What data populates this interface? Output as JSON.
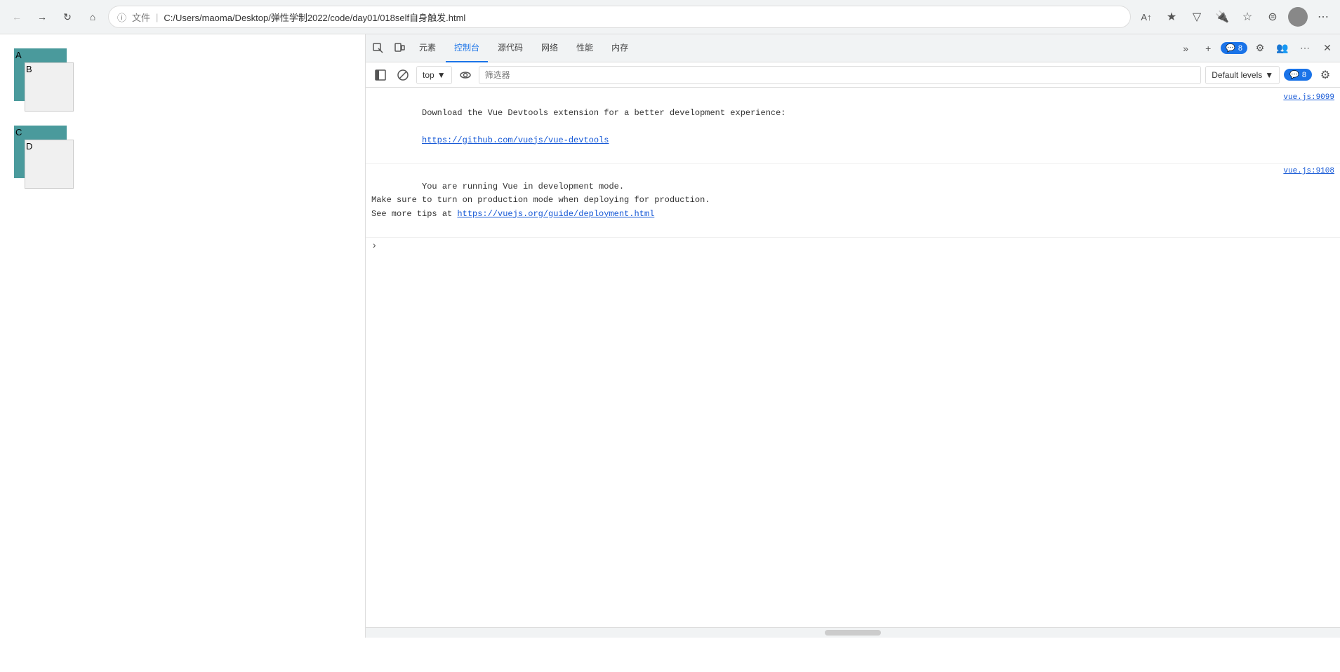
{
  "browser": {
    "back_label": "←",
    "forward_label": "→",
    "reload_label": "↻",
    "home_label": "⌂",
    "address_icon": "ℹ",
    "file_label": "文件",
    "address_text": "C:/Users/maoma/Desktop/弹性学制2022/code/day01/018self自身触发.html",
    "toolbar_icons": [
      "A↑",
      "☆",
      "▽",
      "🔔",
      "☆",
      "⊡",
      "👤",
      "···"
    ]
  },
  "devtools": {
    "tabs": [
      {
        "label": "元素",
        "active": false
      },
      {
        "label": "控制台",
        "active": true
      },
      {
        "label": "源代码",
        "active": false
      },
      {
        "label": "网络",
        "active": false
      },
      {
        "label": "性能",
        "active": false
      },
      {
        "label": "内存",
        "active": false
      }
    ],
    "more_tabs_label": "»",
    "add_tab_label": "+",
    "msg_count": "8",
    "settings_label": "⚙",
    "customize_label": "👥",
    "more_options_label": "···",
    "close_label": "✕",
    "console": {
      "clear_label": "🚫",
      "block_label": "⊘",
      "top_label": "top",
      "eye_label": "👁",
      "filter_placeholder": "筛选器",
      "default_levels_label": "Default levels",
      "msg_count": "8",
      "settings_label": "⚙",
      "messages": [
        {
          "text": "Download the Vue Devtools extension for a better development experience:\nhttps://github.com/vuejs/vue-devtools",
          "link": "https://github.com/vuejs/vue-devtools",
          "source": "vue.js:9099",
          "has_link": true,
          "link_text": "https://github.com/vuejs/vue-devtools",
          "pre_text": "Download the Vue Devtools extension for a better development experience:"
        },
        {
          "text": "You are running Vue in development mode.\nMake sure to turn on production mode when deploying for production.\nSee more tips at https://vuejs.org/guide/deployment.html",
          "source": "vue.js:9108",
          "has_link": true,
          "link_text": "https://vuejs.org/guide/deployment.html",
          "pre_text": "You are running Vue in development mode.\nMake sure to turn on production mode when deploying for production.\nSee more tips at ",
          "post_text": ""
        }
      ]
    }
  },
  "page": {
    "label_a": "A",
    "label_b": "B",
    "label_c": "C",
    "label_d": "D"
  }
}
